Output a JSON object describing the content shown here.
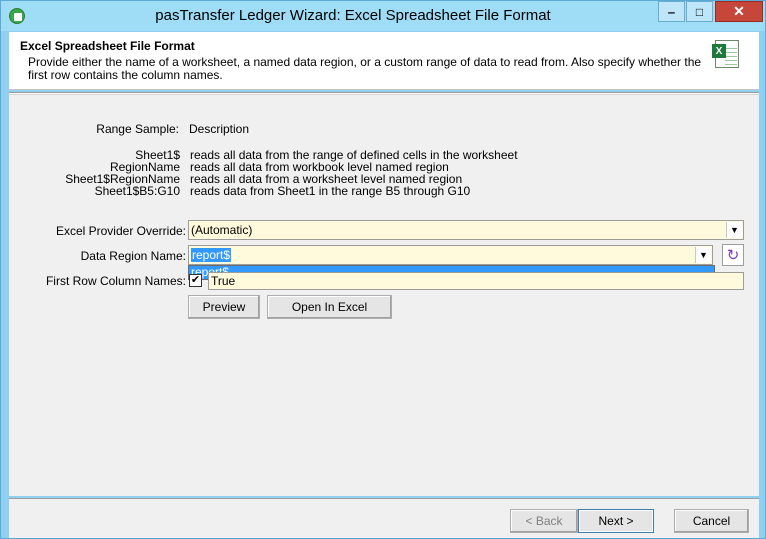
{
  "window": {
    "title": "pasTransfer Ledger Wizard: Excel Spreadsheet File Format",
    "minimize_glyph": "‒",
    "maximize_glyph": "□",
    "close_glyph": "✕"
  },
  "header": {
    "title": "Excel Spreadsheet File Format",
    "description": "Provide either the name of a worksheet, a named data region, or a custom range of data to read from.   Also specify whether the first row contains the column names."
  },
  "samples": {
    "header_label": "Range Sample:",
    "header_desc": "Description",
    "rows": [
      {
        "label": "Sheet1$",
        "desc": "reads all data from the range of defined cells in the worksheet"
      },
      {
        "label": "RegionName",
        "desc": "reads all data from workbook level named region"
      },
      {
        "label": "Sheet1$RegionName",
        "desc": "reads all data from a worksheet level named region"
      },
      {
        "label": "Sheet1$B5:G10",
        "desc": "reads data from Sheet1 in the range B5 through G10"
      }
    ]
  },
  "form": {
    "provider_label": "Excel Provider Override:",
    "provider_value": "(Automatic)",
    "region_label": "Data Region Name:",
    "region_value": "report$",
    "region_options": [
      "report$"
    ],
    "first_row_label": "First Row Column Names:",
    "first_row_checked": true,
    "first_row_value": "True",
    "check_glyph": "✔"
  },
  "actions": {
    "preview": "Preview",
    "open_excel": "Open In Excel"
  },
  "footer": {
    "back": "< Back",
    "next": "Next >",
    "cancel": "Cancel"
  },
  "icons": {
    "app": "app-icon",
    "excel": "excel-file-icon",
    "refresh": "refresh-icon"
  }
}
